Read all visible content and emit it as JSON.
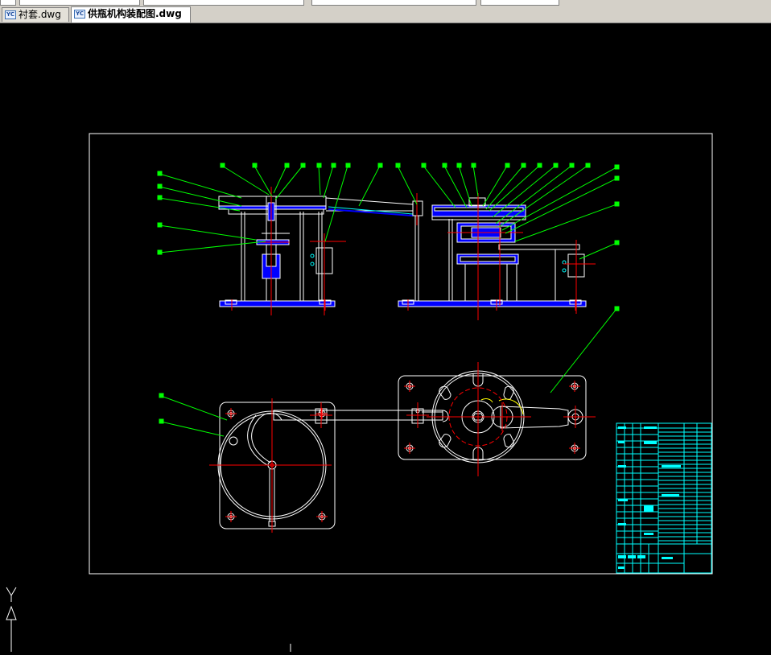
{
  "window": {
    "tabs": [
      {
        "label": "衬套.dwg",
        "icon": "dwg-file-icon",
        "active": false
      },
      {
        "label": "供瓶机构装配图.dwg",
        "icon": "dwg-file-icon",
        "active": true
      }
    ]
  },
  "ucs": {
    "y_label": "Y"
  },
  "icon_badge": "YC",
  "colors": {
    "background": "#000000",
    "frame": "#ffffff",
    "leaders": "#00ff00",
    "centerlines": "#ff0000",
    "hatch": "#0000ff",
    "title_block": "#00ffff",
    "accent": "#ffff00"
  }
}
